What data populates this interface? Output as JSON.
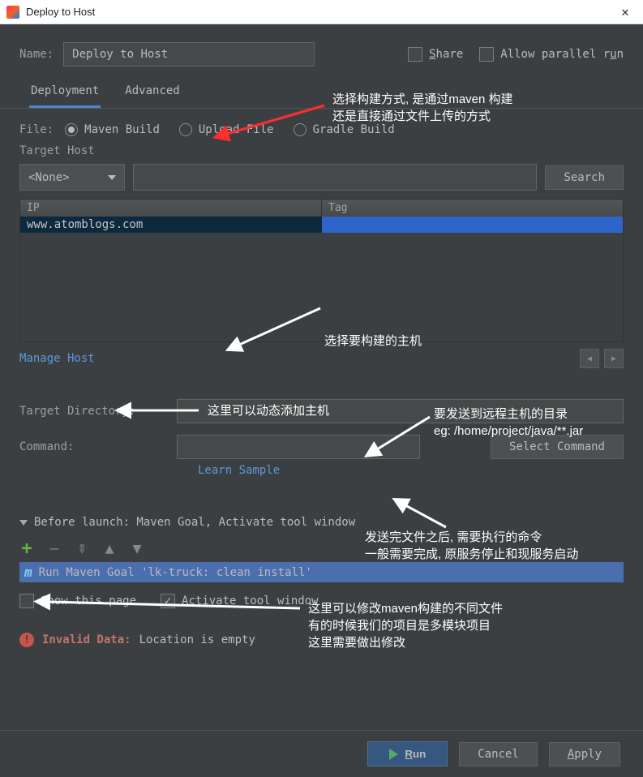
{
  "window": {
    "title": "Deploy to Host"
  },
  "form": {
    "nameLabel": "Name:",
    "nameValue": "Deploy to Host",
    "share": "Share",
    "allowParallel": "Allow parallel run"
  },
  "tabs": {
    "deployment": "Deployment",
    "advanced": "Advanced"
  },
  "file": {
    "label": "File:",
    "options": {
      "maven": "Maven Build",
      "upload": "Upload File",
      "gradle": "Gradle Build"
    }
  },
  "target": {
    "label": "Target Host",
    "dropdown": "<None>",
    "searchBtn": "Search",
    "headers": {
      "ip": "IP",
      "tag": "Tag"
    },
    "row1": {
      "ip": "www.atomblogs.com",
      "tag": ""
    },
    "manage": "Manage Host",
    "pagerPrev": "◀",
    "pagerNext": "▶"
  },
  "fields": {
    "targetDir": "Target Directory:",
    "command": "Command:",
    "selectCmd": "Select Command",
    "learn": "Learn Sample"
  },
  "beforeLaunch": {
    "header": "Before launch: Maven Goal, Activate tool window",
    "maven": "Run Maven Goal 'lk-truck: clean install'",
    "showPage": "Show this page",
    "activate": "Activate tool window"
  },
  "error": {
    "label": "Invalid Data:",
    "msg": "Location is empty"
  },
  "footer": {
    "run": "Run",
    "cancel": "Cancel",
    "apply": "Apply"
  },
  "annotations": {
    "a1": "选择构建方式, 是通过maven 构建\n还是直接通过文件上传的方式",
    "a2": "选择要构建的主机",
    "a3": "这里可以动态添加主机",
    "a4": "要发送到远程主机的目录\neg: /home/project/java/**.jar",
    "a5": "发送完文件之后, 需要执行的命令\n一般需要完成, 原服务停止和现服务启动",
    "a6": "这里可以修改maven构建的不同文件\n有的时候我们的项目是多模块项目\n这里需要做出修改"
  }
}
